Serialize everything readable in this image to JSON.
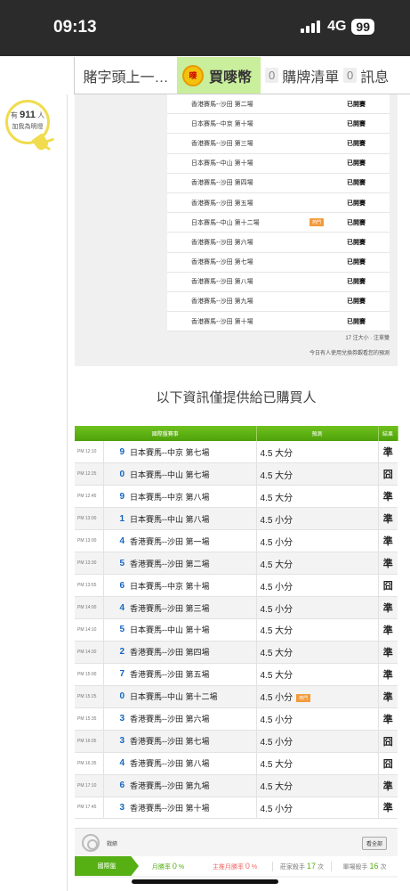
{
  "status": {
    "time": "09:13",
    "network": "4G",
    "battery": "99"
  },
  "tabs": [
    {
      "label": "賭字頭上一…",
      "count": ""
    },
    {
      "label": "買嘜幣",
      "count": "",
      "icon": "coin-icon"
    },
    {
      "label": "購牌清單",
      "count": "0"
    },
    {
      "label": "訊息",
      "count": "0"
    }
  ],
  "bulb": {
    "prefix": "有",
    "count": "911",
    "suffix": "人",
    "line2": "加我為明燈"
  },
  "race_list": [
    {
      "name": "香港賽馬--沙田 第二場",
      "status": "已開賽",
      "hot": false
    },
    {
      "name": "日本賽馬--中京 第十場",
      "status": "已開賽",
      "hot": false
    },
    {
      "name": "香港賽馬--沙田 第三場",
      "status": "已開賽",
      "hot": false
    },
    {
      "name": "日本賽馬--中山 第十場",
      "status": "已開賽",
      "hot": false
    },
    {
      "name": "香港賽馬--沙田 第四場",
      "status": "已開賽",
      "hot": false
    },
    {
      "name": "香港賽馬--沙田 第五場",
      "status": "已開賽",
      "hot": false
    },
    {
      "name": "日本賽馬--中山 第十二場",
      "status": "已開賽",
      "hot": true
    },
    {
      "name": "香港賽馬--沙田 第六場",
      "status": "已開賽",
      "hot": false
    },
    {
      "name": "香港賽馬--沙田 第七場",
      "status": "已開賽",
      "hot": false
    },
    {
      "name": "香港賽馬--沙田 第八場",
      "status": "已開賽",
      "hot": false
    },
    {
      "name": "香港賽馬--沙田 第九場",
      "status": "已開賽",
      "hot": false
    },
    {
      "name": "香港賽馬--沙田 第十場",
      "status": "已開賽",
      "hot": false
    }
  ],
  "hot_badge": "熱門",
  "unit_note": "17 注大小 · 注單雙",
  "today_note": "今日有人使用兌換券觀看您的預測",
  "notice": "以下資訊僅提供給已購買人",
  "table": {
    "headers": [
      "國際盤賽事",
      "預測",
      "結果"
    ],
    "rows": [
      {
        "time": "PM 12:10",
        "no": "9",
        "race": "日本賽馬--中京 第七場",
        "pred": "4.5 大分",
        "result": "準",
        "win": true,
        "hot": false
      },
      {
        "time": "PM 12:25",
        "no": "0",
        "race": "日本賽馬--中山 第七場",
        "pred": "4.5 大分",
        "result": "囧",
        "win": false,
        "hot": false
      },
      {
        "time": "PM 12:45",
        "no": "9",
        "race": "日本賽馬--中京 第八場",
        "pred": "4.5 大分",
        "result": "準",
        "win": true,
        "hot": false
      },
      {
        "time": "PM 13:00",
        "no": "1",
        "race": "日本賽馬--中山 第八場",
        "pred": "4.5 小分",
        "result": "準",
        "win": true,
        "hot": false
      },
      {
        "time": "PM 13:00",
        "no": "4",
        "race": "香港賽馬--沙田 第一場",
        "pred": "4.5 小分",
        "result": "準",
        "win": true,
        "hot": false
      },
      {
        "time": "PM 13:30",
        "no": "5",
        "race": "香港賽馬--沙田 第二場",
        "pred": "4.5 大分",
        "result": "準",
        "win": true,
        "hot": false
      },
      {
        "time": "PM 13:55",
        "no": "6",
        "race": "日本賽馬--中京 第十場",
        "pred": "4.5 小分",
        "result": "囧",
        "win": false,
        "hot": false
      },
      {
        "time": "PM 14:00",
        "no": "4",
        "race": "香港賽馬--沙田 第三場",
        "pred": "4.5 小分",
        "result": "準",
        "win": true,
        "hot": false
      },
      {
        "time": "PM 14:10",
        "no": "5",
        "race": "日本賽馬--中山 第十場",
        "pred": "4.5 大分",
        "result": "準",
        "win": true,
        "hot": false
      },
      {
        "time": "PM 14:30",
        "no": "2",
        "race": "香港賽馬--沙田 第四場",
        "pred": "4.5 大分",
        "result": "準",
        "win": true,
        "hot": false
      },
      {
        "time": "PM 15:00",
        "no": "7",
        "race": "香港賽馬--沙田 第五場",
        "pred": "4.5 大分",
        "result": "準",
        "win": true,
        "hot": false
      },
      {
        "time": "PM 15:25",
        "no": "0",
        "race": "日本賽馬--中山 第十二場",
        "pred": "4.5 小分",
        "result": "準",
        "win": true,
        "hot": true
      },
      {
        "time": "PM 15:35",
        "no": "3",
        "race": "香港賽馬--沙田 第六場",
        "pred": "4.5 小分",
        "result": "準",
        "win": true,
        "hot": false
      },
      {
        "time": "PM 16:05",
        "no": "3",
        "race": "香港賽馬--沙田 第七場",
        "pred": "4.5 小分",
        "result": "囧",
        "win": false,
        "hot": false
      },
      {
        "time": "PM 16:35",
        "no": "4",
        "race": "香港賽馬--沙田 第八場",
        "pred": "4.5 大分",
        "result": "囧",
        "win": false,
        "hot": false
      },
      {
        "time": "PM 17:10",
        "no": "6",
        "race": "香港賽馬--沙田 第九場",
        "pred": "4.5 大分",
        "result": "準",
        "win": true,
        "hot": false
      },
      {
        "time": "PM 17:45",
        "no": "3",
        "race": "香港賽馬--沙田 第十場",
        "pred": "4.5 小分",
        "result": "準",
        "win": true,
        "hot": false
      }
    ]
  },
  "record": {
    "title": "戰績",
    "view_all": "看全部",
    "tab": "國際盤",
    "month_win_label": "月勝率",
    "month_win": "0",
    "main_win_label": "主推月勝率",
    "main_win": "0",
    "banker_label": "莊家殺手",
    "banker": "17",
    "single_label": "單場殺手",
    "single": "16",
    "pct": "%",
    "times": "次"
  },
  "colors": {
    "green": "#56b014",
    "win": "#1a9b2a",
    "hot": "#f29a3b"
  }
}
